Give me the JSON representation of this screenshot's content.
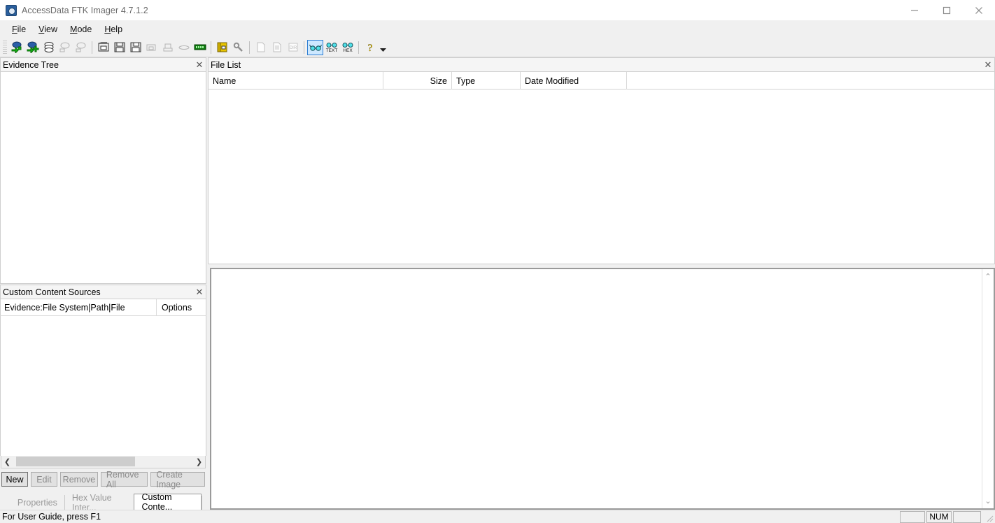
{
  "window": {
    "title": "AccessData FTK Imager 4.7.1.2",
    "icon": "app-disk-icon",
    "controls": {
      "minimize": "minimize-icon",
      "maximize": "maximize-icon",
      "close": "close-icon"
    }
  },
  "menubar": {
    "items": [
      {
        "label": "File",
        "accel": "F"
      },
      {
        "label": "View",
        "accel": "V"
      },
      {
        "label": "Mode",
        "accel": "M"
      },
      {
        "label": "Help",
        "accel": "H"
      }
    ]
  },
  "toolbar": {
    "groups": [
      {
        "buttons": [
          {
            "name": "add-evidence-item-icon",
            "enabled": true
          },
          {
            "name": "add-all-attached-devices-icon",
            "enabled": true
          },
          {
            "name": "image-mounting-icon",
            "enabled": true
          },
          {
            "name": "remove-evidence-item-icon",
            "enabled": false
          },
          {
            "name": "remove-all-evidence-items-icon",
            "enabled": false
          }
        ]
      },
      {
        "buttons": [
          {
            "name": "create-disk-image-icon",
            "enabled": true
          },
          {
            "name": "export-disk-image-icon",
            "enabled": true
          },
          {
            "name": "export-logical-image-icon",
            "enabled": true
          },
          {
            "name": "add-to-custom-content-image-icon",
            "enabled": false
          },
          {
            "name": "create-custom-content-image-icon",
            "enabled": false
          },
          {
            "name": "decrypt-ad1-image-icon",
            "enabled": false
          },
          {
            "name": "verify-drive-image-icon",
            "enabled": true
          }
        ]
      },
      {
        "buttons": [
          {
            "name": "capture-memory-icon",
            "enabled": true
          },
          {
            "name": "obtain-protected-files-icon",
            "enabled": true
          }
        ]
      },
      {
        "buttons": [
          {
            "name": "export-files-icon",
            "enabled": false
          },
          {
            "name": "export-file-hash-list-icon",
            "enabled": false
          },
          {
            "name": "export-directory-listing-icon",
            "enabled": false
          }
        ]
      },
      {
        "buttons": [
          {
            "name": "view-mode-automatic-icon",
            "enabled": true,
            "selected": true
          },
          {
            "name": "view-mode-text-icon",
            "enabled": true,
            "label": "TEXT"
          },
          {
            "name": "view-mode-hex-icon",
            "enabled": true,
            "label": "HEX"
          }
        ]
      },
      {
        "buttons": [
          {
            "name": "help-icon",
            "enabled": true
          }
        ]
      }
    ],
    "overflow": "toolbar-overflow-chevron"
  },
  "evidence_tree": {
    "title": "Evidence Tree",
    "close": "close-icon",
    "items": []
  },
  "file_list": {
    "title": "File List",
    "close": "close-icon",
    "columns": [
      "Name",
      "Size",
      "Type",
      "Date Modified",
      ""
    ],
    "rows": []
  },
  "custom_content": {
    "title": "Custom Content Sources",
    "close": "close-icon",
    "columns": [
      "Evidence:File System|Path|File",
      "Options"
    ],
    "rows": [],
    "scrollbar": {
      "left_arrow": "chevron-left-icon",
      "right_arrow": "chevron-right-icon"
    },
    "buttons": [
      {
        "label": "New",
        "enabled": true
      },
      {
        "label": "Edit",
        "enabled": false
      },
      {
        "label": "Remove",
        "enabled": false
      },
      {
        "label": "Remove All",
        "enabled": false
      },
      {
        "label": "Create Image",
        "enabled": false
      }
    ]
  },
  "bottom_tabs": {
    "tabs": [
      {
        "label": "Properties",
        "active": false
      },
      {
        "label": "Hex Value Inter...",
        "active": false
      },
      {
        "label": "Custom Conte...",
        "active": true
      }
    ]
  },
  "viewer": {
    "content": "",
    "scrollbar": {
      "up_arrow": "chevron-up-icon",
      "down_arrow": "chevron-down-icon"
    }
  },
  "statusbar": {
    "message": "For User Guide, press F1",
    "panes": [
      "",
      "NUM",
      ""
    ],
    "grip": "resize-grip-icon"
  }
}
